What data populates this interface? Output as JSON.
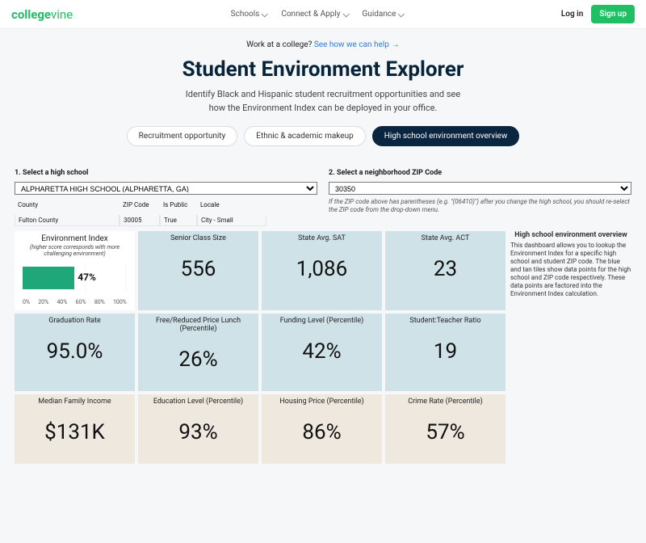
{
  "nav": {
    "brand_a": "college",
    "brand_b": "vine",
    "items": [
      "Schools",
      "Connect & Apply",
      "Guidance"
    ],
    "login": "Log in",
    "signup": "Sign up"
  },
  "hero": {
    "work_prompt": "Work at a college? ",
    "work_link": "See how we can help",
    "title": "Student Environment Explorer",
    "sub1": "Identify Black and Hispanic student recruitment opportunities and see",
    "sub2": "how the Environment Index can be deployed in your office."
  },
  "tabs": {
    "t1": "Recruitment opportunity",
    "t2": "Ethnic & academic makeup",
    "t3": "High school environment overview"
  },
  "selects": {
    "hs_label": "1. Select a high school",
    "hs_value": "ALPHARETTA HIGH SCHOOL (ALPHARETTA, GA)",
    "zip_label": "2. Select a neighborhood ZIP Code",
    "zip_value": "30350",
    "zip_note": "If the ZIP code above has parentheses (e.g. \"(06410)\") after you change the high school, you should re-select the ZIP code from the drop-down menu."
  },
  "meta": {
    "h_county": "County",
    "h_zip": "ZIP Code",
    "h_public": "Is Public",
    "h_locale": "Locale",
    "v_county": "Fulton County",
    "v_zip": "30005",
    "v_public": "True",
    "v_locale": "City - Small"
  },
  "env": {
    "title": "Environment Index",
    "sub": "(higher score corresponds with more challenging environment)",
    "value": "47%",
    "pct": 47,
    "ticks": [
      "0%",
      "20%",
      "40%",
      "60%",
      "80%",
      "100%"
    ]
  },
  "tiles": {
    "senior": {
      "label": "Senior Class Size",
      "value": "556"
    },
    "sat": {
      "label": "State Avg. SAT",
      "value": "1,086"
    },
    "act": {
      "label": "State Avg. ACT",
      "value": "23"
    },
    "grad": {
      "label": "Graduation Rate",
      "value": "95.0%"
    },
    "lunch": {
      "label": "Free/Reduced Price Lunch (Percentile)",
      "value": "26%"
    },
    "funding": {
      "label": "Funding Level (Percentile)",
      "value": "42%"
    },
    "ratio": {
      "label": "Student:Teacher Ratio",
      "value": "19"
    },
    "income": {
      "label": "Median Family Income",
      "value": "$131K"
    },
    "edu": {
      "label": "Education Level (Percentile)",
      "value": "93%"
    },
    "housing": {
      "label": "Housing Price (Percentile)",
      "value": "86%"
    },
    "crime": {
      "label": "Crime Rate (Percentile)",
      "value": "57%"
    }
  },
  "side": {
    "title": "High school environment overview",
    "body": "This dashboard allows you to lookup the Environment Index for a specific high school and student ZIP code. The blue and tan tiles show data points for the high school and ZIP code respectively. These data points are factored into the Environment Index calculation."
  }
}
